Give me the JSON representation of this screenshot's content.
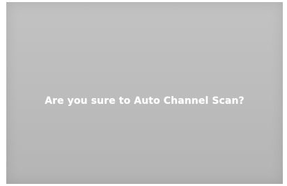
{
  "dialog": {
    "prompt": "Are you sure to Auto Channel Scan?"
  },
  "colors": {
    "screen_background": "#bcbcbc",
    "text": "#ffffff"
  }
}
